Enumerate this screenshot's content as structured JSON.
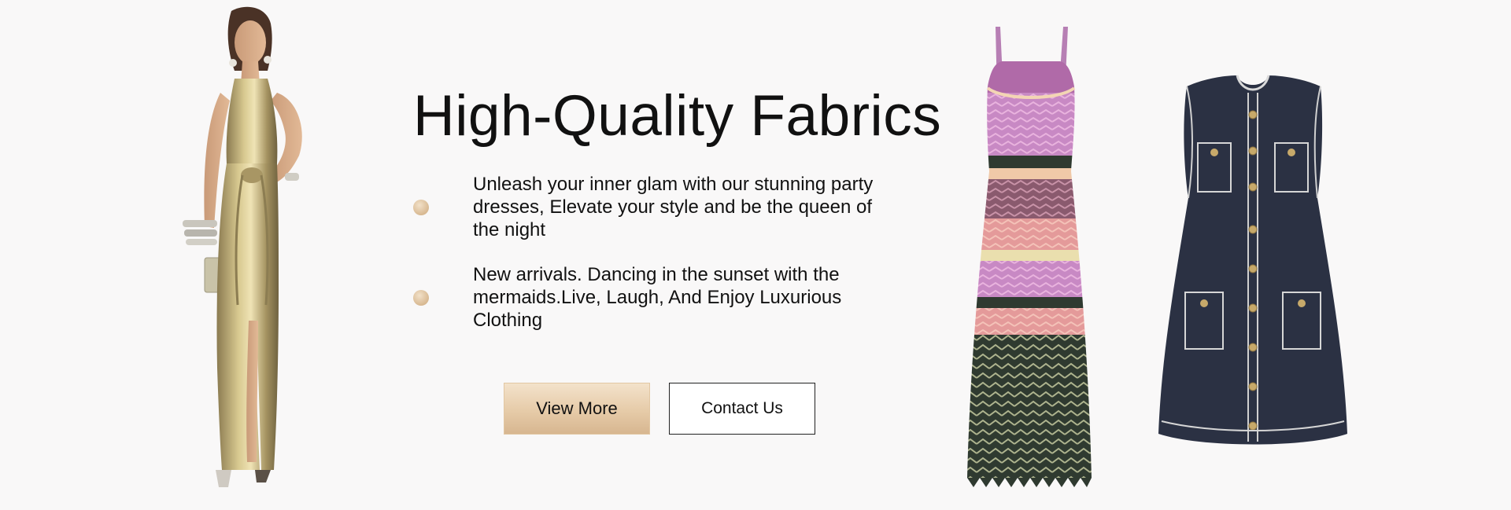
{
  "hero": {
    "title": "High-Quality Fabrics",
    "bullets": [
      {
        "text": "Unleash your inner glam with our stunning party dresses, Elevate your style and be the queen of the night"
      },
      {
        "text": "New arrivals. Dancing in the sunset with the mermaids.Live, Laugh, And Enjoy Luxurious Clothing"
      }
    ],
    "buttons": {
      "primary_label": "View More",
      "secondary_label": "Contact Us"
    }
  },
  "images": {
    "left": "model-gold-metallic-gown",
    "center_right": "striped-chevron-knit-maxi-dress",
    "right": "navy-tweed-button-front-mini-dress"
  },
  "colors": {
    "background": "#f9f8f8",
    "accent_gold": "#e6cba8",
    "navy": "#2b3143",
    "text": "#111111"
  }
}
